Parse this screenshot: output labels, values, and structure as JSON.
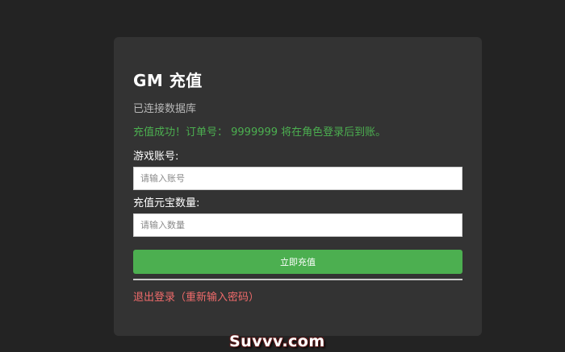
{
  "card": {
    "title": "GM 充值",
    "status": "已连接数据库",
    "success_message": "充值成功！订单号： 9999999 将在角色登录后到账。",
    "account_label": "游戏账号:",
    "account_placeholder": "请输入账号",
    "account_value": "",
    "amount_label": "充值元宝数量:",
    "amount_placeholder": "请输入数量",
    "amount_value": "",
    "submit_label": "立即充值",
    "logout_label": "退出登录（重新输入密码）"
  },
  "watermark": {
    "text": "Suvvv.com"
  },
  "colors": {
    "background": "#232323",
    "card": "#333333",
    "accent_green": "#4caf50",
    "logout_red": "#f06b6b",
    "status_gray": "#b8b8b8"
  }
}
